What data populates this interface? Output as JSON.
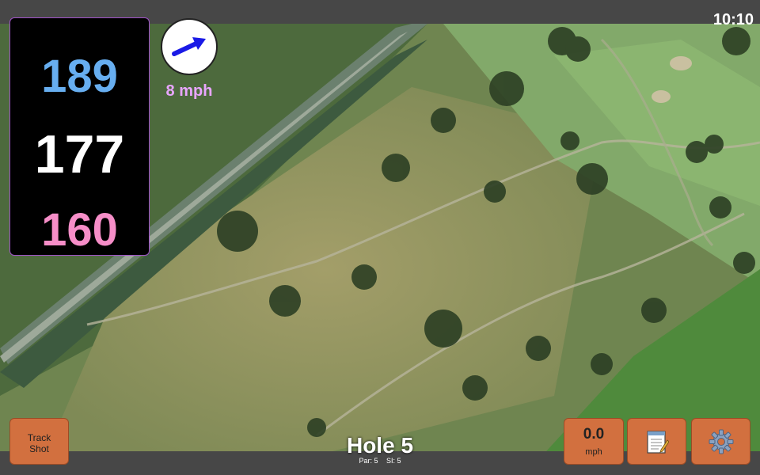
{
  "status": {
    "time": "10:10"
  },
  "distances": {
    "back": "189",
    "middle": "177",
    "front": "160"
  },
  "wind": {
    "speed_label": "8 mph",
    "direction_icon": "arrow-icon",
    "arrow_color": "#1a1ae6"
  },
  "hole": {
    "title": "Hole 5",
    "par": "Par: 5",
    "si": "SI: 5"
  },
  "buttons": {
    "track_shot": {
      "line1": "Track",
      "line2": "Shot"
    },
    "speed": {
      "value": "0.0",
      "unit": "mph"
    },
    "notes_icon": "notepad-icon",
    "settings_icon": "gear-icon"
  },
  "colors": {
    "back": "#67aef0",
    "middle": "#ffffff",
    "front": "#f68ec8",
    "wind_text": "#e9a6ff",
    "button_bg": "#d2703f",
    "panel_border": "#a052c8"
  }
}
